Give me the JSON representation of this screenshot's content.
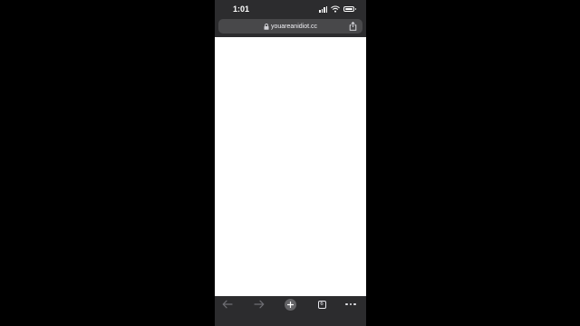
{
  "status_bar": {
    "time": "1:01",
    "icons": [
      "signal-icon",
      "wifi-icon",
      "battery-icon"
    ]
  },
  "address_bar": {
    "url": "youareanidiot.cc",
    "icons": [
      "lock-icon",
      "share-icon"
    ]
  },
  "toolbar": {
    "icons": [
      "back-arrow-icon",
      "forward-arrow-icon",
      "new-tab-plus-icon",
      "tabs-icon",
      "more-menu-icon"
    ],
    "tab_count": "6"
  },
  "colors": {
    "chrome_bg": "#2c2c2e",
    "address_bar_bg": "#48484a",
    "page_bg": "#ffffff",
    "disabled_icon": "#6e6e73"
  }
}
